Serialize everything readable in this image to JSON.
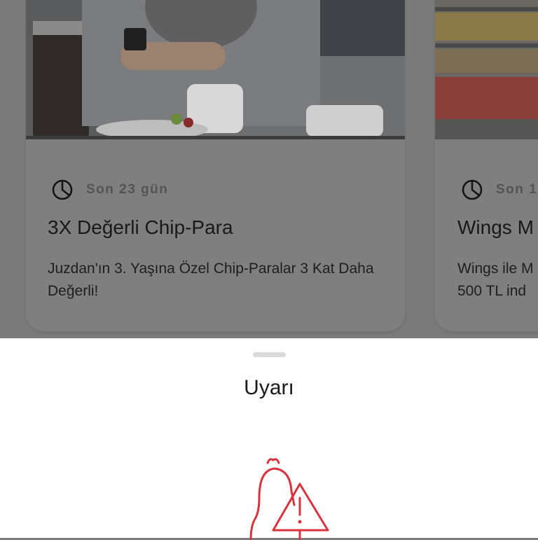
{
  "cards": [
    {
      "image_icon": "person-with-phone-photo",
      "meta_icon": "pie-clock-icon",
      "days_left": "Son 23 gün",
      "title": "3X Değerli Chip-Para",
      "description": "Juzdan'ın 3. Yaşına Özel Chip-Paralar 3 Kat Daha Değerli!"
    },
    {
      "image_icon": "supermarket-shelves-photo",
      "meta_icon": "pie-clock-icon",
      "days_left": "Son 1",
      "title": "Wings M",
      "description_line1": "Wings ile M",
      "description_line2": "500 TL ind"
    }
  ],
  "sheet": {
    "title": "Uyarı",
    "illustration_icon": "bell-warning-icon",
    "accent_color": "#d7343d"
  }
}
